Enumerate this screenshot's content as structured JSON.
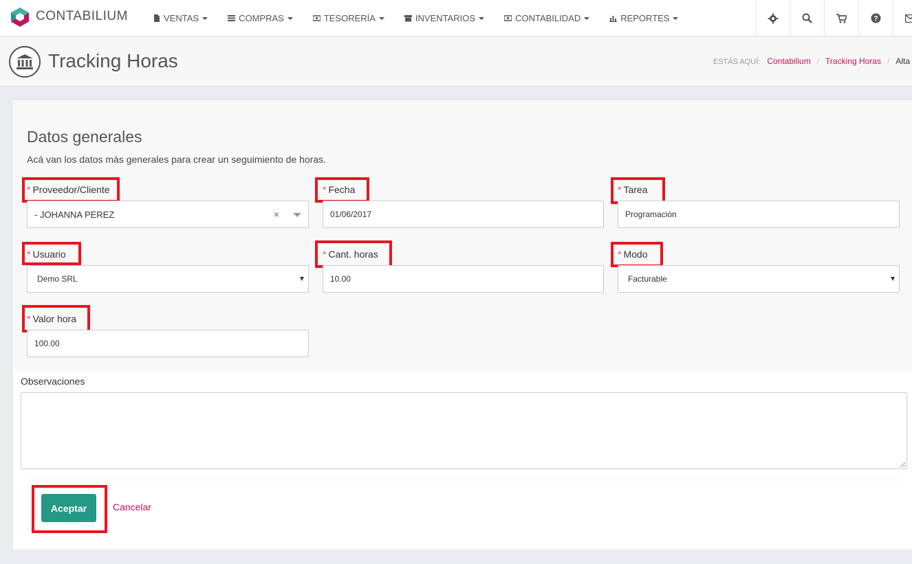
{
  "brand": {
    "name": "CONTABILIUM"
  },
  "nav": [
    {
      "label": "VENTAS",
      "icon": "document-icon"
    },
    {
      "label": "COMPRAS",
      "icon": "list-icon"
    },
    {
      "label": "TESORERÍA",
      "icon": "money-icon"
    },
    {
      "label": "INVENTARIOS",
      "icon": "archive-icon"
    },
    {
      "label": "CONTABILIDAD",
      "icon": "money-icon"
    },
    {
      "label": "REPORTES",
      "icon": "bar-chart-icon"
    }
  ],
  "tools": [
    "gear-icon",
    "search-icon",
    "cart-icon",
    "help-icon",
    "mail-icon"
  ],
  "header": {
    "title": "Tracking Horas",
    "breadcrumb_label": "ESTÁS AQUÍ:",
    "crumbs": [
      "Contabilium",
      "Tracking Horas"
    ],
    "current": "Alta"
  },
  "form": {
    "section_title": "Datos generales",
    "section_desc": "Acá van los datos más generales para crear un seguimiento de horas.",
    "required_mark": "*",
    "proveedor": {
      "label": "Proveedor/Cliente",
      "value": "- JOHANNA PEREZ",
      "clear": "×"
    },
    "fecha": {
      "label": "Fecha",
      "value": "01/06/2017"
    },
    "tarea": {
      "label": "Tarea",
      "value": "Programación"
    },
    "usuario": {
      "label": "Usuario",
      "value": "Demo SRL"
    },
    "horas": {
      "label": "Cant. horas",
      "value": "10.00"
    },
    "modo": {
      "label": "Modo",
      "value": "Facturable"
    },
    "valor": {
      "label": "Valor hora",
      "value": "100.00"
    },
    "observaciones": {
      "label": "Observaciones",
      "value": ""
    }
  },
  "actions": {
    "accept": "Aceptar",
    "cancel": "Cancelar"
  },
  "colors": {
    "accent": "#c0145d",
    "primary_button": "#239885",
    "highlight": "#e8161f",
    "required": "#d9534f"
  }
}
